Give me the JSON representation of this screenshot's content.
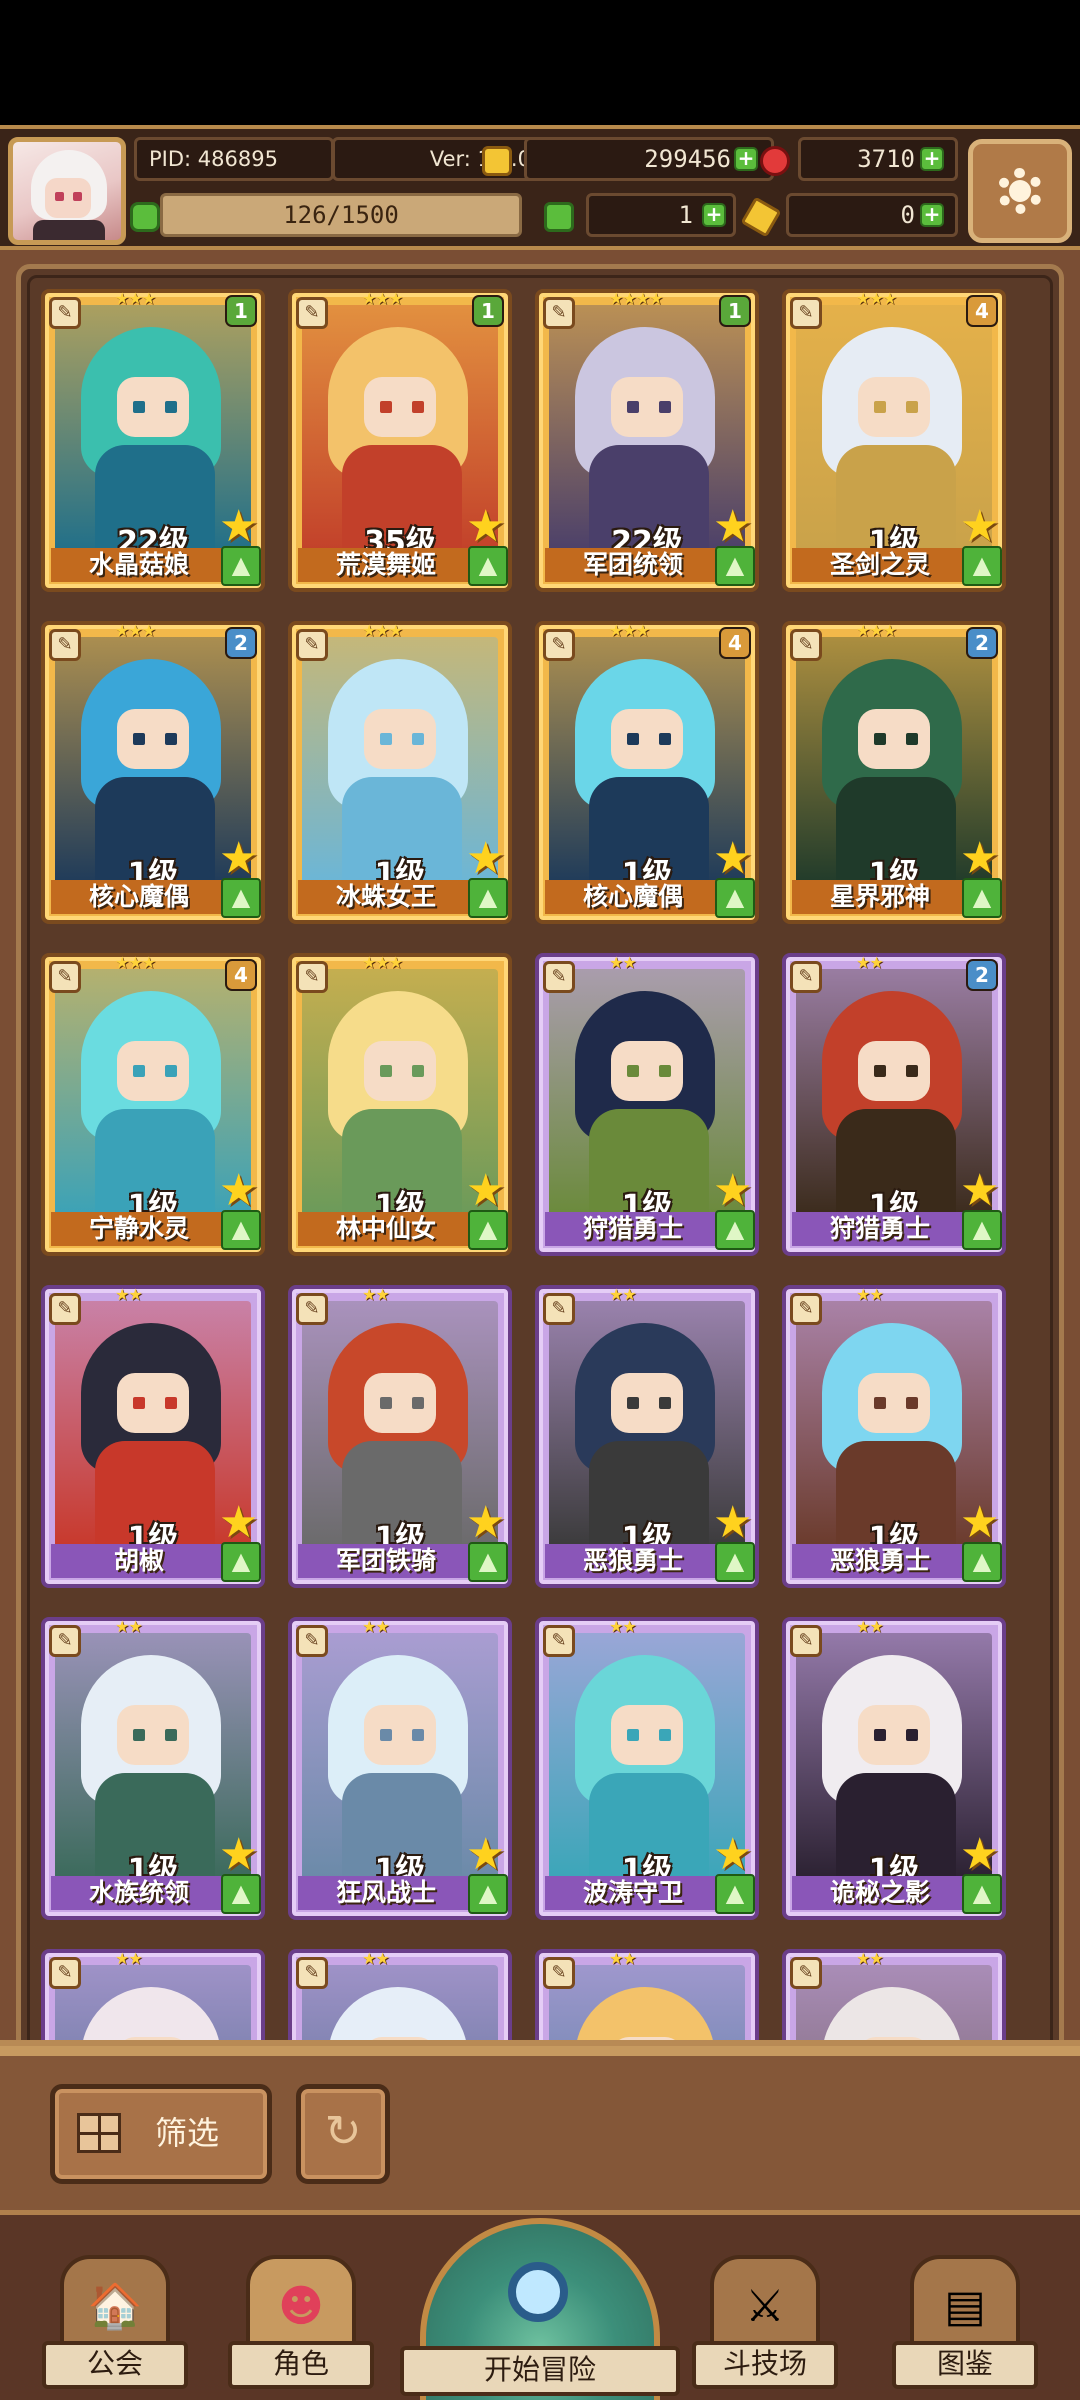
{
  "header": {
    "pid": "PID: 486895",
    "version": "Ver: 1.0.0.8",
    "gold": "299456",
    "gems": "3710",
    "stamina": "126/1500",
    "clover": "1",
    "keys": "0"
  },
  "characters": [
    {
      "name": "水晶菇娘",
      "level": "22级",
      "stars": "★★★",
      "badge": "1",
      "rarity": "gold"
    },
    {
      "name": "荒漠舞姬",
      "level": "35级",
      "stars": "★★★",
      "badge": "1",
      "rarity": "gold"
    },
    {
      "name": "军团统领",
      "level": "22级",
      "stars": "★★★★",
      "badge": "1",
      "rarity": "gold"
    },
    {
      "name": "圣剑之灵",
      "level": "1级",
      "stars": "★★★",
      "badge": "4",
      "rarity": "gold"
    },
    {
      "name": "核心魔偶",
      "level": "1级",
      "stars": "★★★",
      "badge": "2",
      "rarity": "gold"
    },
    {
      "name": "冰蛛女王",
      "level": "1级",
      "stars": "★★★",
      "badge": "",
      "rarity": "gold"
    },
    {
      "name": "核心魔偶",
      "level": "1级",
      "stars": "★★★",
      "badge": "4",
      "rarity": "gold"
    },
    {
      "name": "星界邪神",
      "level": "1级",
      "stars": "★★★",
      "badge": "2",
      "rarity": "gold"
    },
    {
      "name": "宁静水灵",
      "level": "1级",
      "stars": "★★★",
      "badge": "4",
      "rarity": "gold"
    },
    {
      "name": "林中仙女",
      "level": "1级",
      "stars": "★★★",
      "badge": "",
      "rarity": "gold"
    },
    {
      "name": "狩猎勇士",
      "level": "1级",
      "stars": "★★",
      "badge": "",
      "rarity": "purple"
    },
    {
      "name": "狩猎勇士",
      "level": "1级",
      "stars": "★★",
      "badge": "2",
      "rarity": "purple"
    },
    {
      "name": "胡椒",
      "level": "1级",
      "stars": "★★",
      "badge": "",
      "rarity": "purple"
    },
    {
      "name": "军团铁骑",
      "level": "1级",
      "stars": "★★",
      "badge": "",
      "rarity": "purple"
    },
    {
      "name": "恶狼勇士",
      "level": "1级",
      "stars": "★★",
      "badge": "",
      "rarity": "purple"
    },
    {
      "name": "恶狼勇士",
      "level": "1级",
      "stars": "★★",
      "badge": "",
      "rarity": "purple"
    },
    {
      "name": "水族统领",
      "level": "1级",
      "stars": "★★",
      "badge": "",
      "rarity": "purple"
    },
    {
      "name": "狂风战士",
      "level": "1级",
      "stars": "★★",
      "badge": "",
      "rarity": "purple"
    },
    {
      "name": "波涛守卫",
      "level": "1级",
      "stars": "★★",
      "badge": "",
      "rarity": "purple"
    },
    {
      "name": "诡秘之影",
      "level": "1级",
      "stars": "★★",
      "badge": "",
      "rarity": "purple"
    },
    {
      "name": "",
      "level": "",
      "stars": "★★",
      "badge": "",
      "rarity": "purple"
    },
    {
      "name": "",
      "level": "",
      "stars": "★★",
      "badge": "",
      "rarity": "purple"
    },
    {
      "name": "",
      "level": "",
      "stars": "★★",
      "badge": "",
      "rarity": "purple"
    },
    {
      "name": "",
      "level": "",
      "stars": "★★",
      "badge": "",
      "rarity": "purple"
    }
  ],
  "filter": {
    "label": "筛选"
  },
  "nav": {
    "guild": "公会",
    "character": "角色",
    "start": "开始冒险",
    "arena": "斗技场",
    "codex": "图鉴"
  },
  "icons": {
    "gold": "coin-icon",
    "gem": "ruby-icon",
    "stamina": "clover-icon",
    "key": "key-icon",
    "settings": "gear-icon"
  }
}
